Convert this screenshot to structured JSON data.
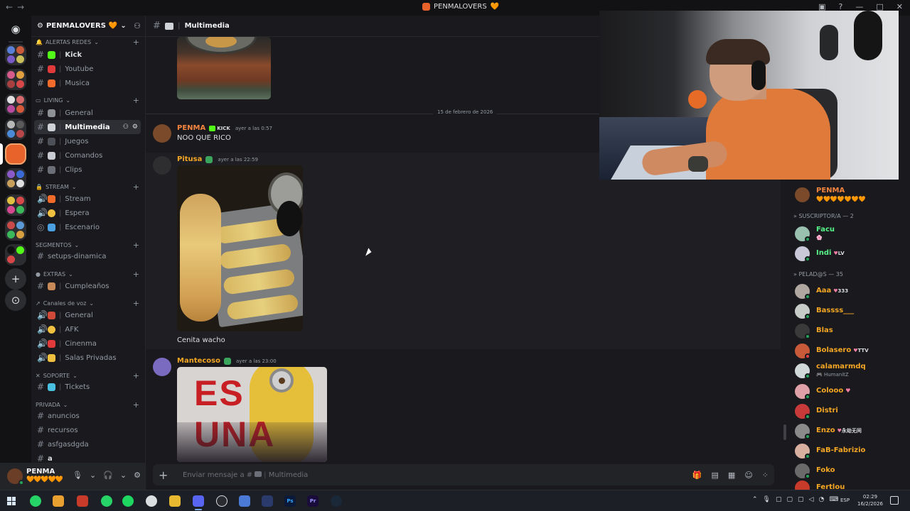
{
  "titlebar": {
    "title": "PENMALOVERS",
    "heart": "🧡"
  },
  "server": {
    "name": "PENMALOVERS",
    "heart": "🧡"
  },
  "sidebar": {
    "categories": [
      {
        "key": "alertas",
        "label": "ALERTAS REDES"
      },
      {
        "key": "living",
        "label": "LIVING"
      },
      {
        "key": "stream",
        "label": "STREAM"
      },
      {
        "key": "segmentos",
        "label": "SEGMENTOS"
      },
      {
        "key": "extras",
        "label": "EXTRAS"
      },
      {
        "key": "voz",
        "label": "Canales de voz"
      },
      {
        "key": "soporte",
        "label": "SOPORTE"
      },
      {
        "key": "privada",
        "label": "PRIVADA"
      }
    ],
    "channels": {
      "kick": "Kick",
      "youtube": "Youtube",
      "musica": "Musica",
      "general": "General",
      "multimedia": "Multimedia",
      "juegos": "Juegos",
      "comandos": "Comandos",
      "clips": "Clips",
      "stream": "Stream",
      "espera": "Espera",
      "escenario": "Escenario",
      "setups": "setups-dinamica",
      "cumpleanos": "Cumpleaños",
      "voz_general": "General",
      "afk": "AFK",
      "cinenma": "Cinenma",
      "salas": "Salas Privadas",
      "tickets": "Tickets",
      "anuncios": "anuncios",
      "recursos": "recursos",
      "asfgasdgda": "asfgasdgda",
      "a": "a"
    }
  },
  "user_panel": {
    "name": "PENMA",
    "hearts": "🧡🧡🧡🧡🧡"
  },
  "chat": {
    "channel": "Multimedia",
    "date_divider": "15 de febrero de 2026",
    "messages": [
      {
        "author": "PENMA",
        "badge": "KICK",
        "time": "ayer a las 0:57",
        "text": "NOO QUE RICO"
      },
      {
        "author": "Pitusa",
        "time": "ayer a las 22:59",
        "text": "Cenita wacho"
      },
      {
        "author": "Mantecoso",
        "time": "ayer a las 23:00",
        "image_text": "ES UNA"
      }
    ],
    "composer_placeholder": "Enviar mensaje a #",
    "composer_channel": "Multimedia"
  },
  "members": {
    "top_member": {
      "name": "PENMA",
      "hearts": "🧡🧡🧡🧡🧡🧡🧡"
    },
    "groups": [
      {
        "label": "SUSCRIPTOR/A — 2"
      },
      {
        "label": "PELAD@S — 35"
      }
    ],
    "subs": [
      {
        "name": "Facu",
        "sub": "🌸",
        "color": "#57f287"
      },
      {
        "name": "Indi",
        "tag": "LV",
        "color": "#57f287"
      }
    ],
    "list": [
      {
        "name": "Aaa",
        "tag": "333",
        "color": "#f5a623"
      },
      {
        "name": "Bassss___",
        "color": "#f5a623"
      },
      {
        "name": "Blas",
        "color": "#f5a623"
      },
      {
        "name": "Bolasero",
        "tag": "TTV",
        "color": "#f5a623"
      },
      {
        "name": "calamarmdq",
        "sub": "HumanitZ",
        "color": "#f5a623"
      },
      {
        "name": "Colooo",
        "color": "#f5a623"
      },
      {
        "name": "Distri",
        "color": "#f5a623"
      },
      {
        "name": "Enzo",
        "tag": "永劫无间",
        "color": "#f5a623"
      },
      {
        "name": "FaB-Fabrizio",
        "color": "#f5a623"
      },
      {
        "name": "Foko",
        "color": "#f5a623"
      },
      {
        "name": "Fertlou",
        "color": "#f5a623"
      }
    ]
  },
  "taskbar": {
    "lang": "ESP",
    "time": "02:29",
    "date": "16/2/2026",
    "apps": [
      "Ps",
      "Pr"
    ]
  },
  "colors": {
    "accent_orange": "#e8632b",
    "name_orange": "#f5a623",
    "online": "#23a55a"
  }
}
